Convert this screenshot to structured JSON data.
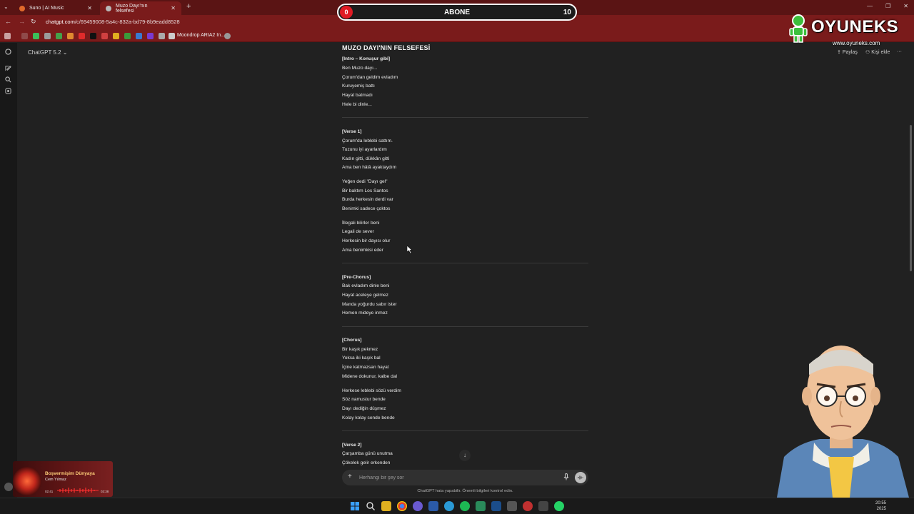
{
  "browser": {
    "tabs": [
      {
        "label": "Suno | AI Music",
        "active": false
      },
      {
        "label": "Muzo Dayı'nın felsefesi",
        "active": true
      }
    ],
    "tab_close": "✕",
    "new_tab": "+",
    "url_host": "chatgpt.com",
    "url_path": "/c/69459008-5a4c-832a-bd79-8b9eadd8528",
    "bookmark_label": "Moondrop ARIA2 In...",
    "window_controls": [
      "—",
      "❐",
      "✕"
    ]
  },
  "overlay": {
    "subscribe_left": "0",
    "subscribe_label": "ABONE",
    "subscribe_right": "10",
    "logo_text": "OYUNEKS",
    "logo_url": "www.oyuneks.com"
  },
  "chatgpt": {
    "model_label": "ChatGPT 5.2",
    "share_label": "Paylaş",
    "add_person_label": "Kişi ekle",
    "more_label": "···",
    "composer_plus": "+",
    "composer_placeholder": "Herhangi bir şey sor",
    "disclaimer": "ChatGPT hata yapabilir. Önemli bilgileri kontrol edin.",
    "scroll_down": "↓"
  },
  "document": {
    "title": "MUZO DAYI'NIN FELSEFESİ",
    "lines": [
      {
        "text": "[Intro – Konuşur gibi]",
        "heading": true
      },
      {
        "text": "Ben Muzo dayı..."
      },
      {
        "text": "Çorum'dan geldim evladım"
      },
      {
        "text": "Kuruyemiş battı"
      },
      {
        "text": "Hayat batmadı"
      },
      {
        "text": "Hele bi dinle..."
      },
      {
        "text": "[Verse 1]",
        "heading": true
      },
      {
        "text": "Çorum'da leblebi sattım."
      },
      {
        "text": "Tuzunu iyi ayarlardım"
      },
      {
        "text": "Kadın gitti, dükkân gitti"
      },
      {
        "text": "Ama ben hâlâ ayaktaydım"
      },
      {
        "text": "Yeğen dedi \"Dayı gel\""
      },
      {
        "text": "Bir baktım Los Santos"
      },
      {
        "text": "Burda herkesin derdi var"
      },
      {
        "text": "Benimki sadece çoktos"
      },
      {
        "text": "İllegali bilirler beni"
      },
      {
        "text": "Legali de sever"
      },
      {
        "text": "Herkesin bir dayısı olur"
      },
      {
        "text": "Ama benimkisi eder"
      },
      {
        "text": "[Pre-Chorus]",
        "heading": true
      },
      {
        "text": "Bak evladım dinle beni"
      },
      {
        "text": "Hayat aceleye gelmez"
      },
      {
        "text": "Manda yoğurdu sabır ister"
      },
      {
        "text": "Hemen mideye inmez"
      },
      {
        "text": "[Chorus]",
        "heading": true
      },
      {
        "text": "Bir kaşık pekmez"
      },
      {
        "text": "Yoksa iki kaşık bal"
      },
      {
        "text": "İçine katmazsan hayat"
      },
      {
        "text": "Midene dokunur, kalbe dal"
      },
      {
        "text": "Herkese leblebi sözü verdim"
      },
      {
        "text": "Söz namustur bende"
      },
      {
        "text": "Dayı dediğin düşmez"
      },
      {
        "text": "Kolay kolay sende bende"
      },
      {
        "text": "[Verse 2]",
        "heading": true
      },
      {
        "text": "Çarşamba günü unutma"
      },
      {
        "text": "Çökelek gelir erkenden"
      }
    ]
  },
  "music_player": {
    "title": "Boşvermişim Dünyaya",
    "artist": "Cem Yılmaz",
    "elapsed": "02:41",
    "duration": "03:38"
  },
  "taskbar": {
    "time": "20:55",
    "date": "2025"
  },
  "colors": {
    "browser_dark": "#5a1414",
    "browser_red": "#7a1b1b",
    "chat_bg": "#212121",
    "subscribe_red": "#e01b24"
  }
}
